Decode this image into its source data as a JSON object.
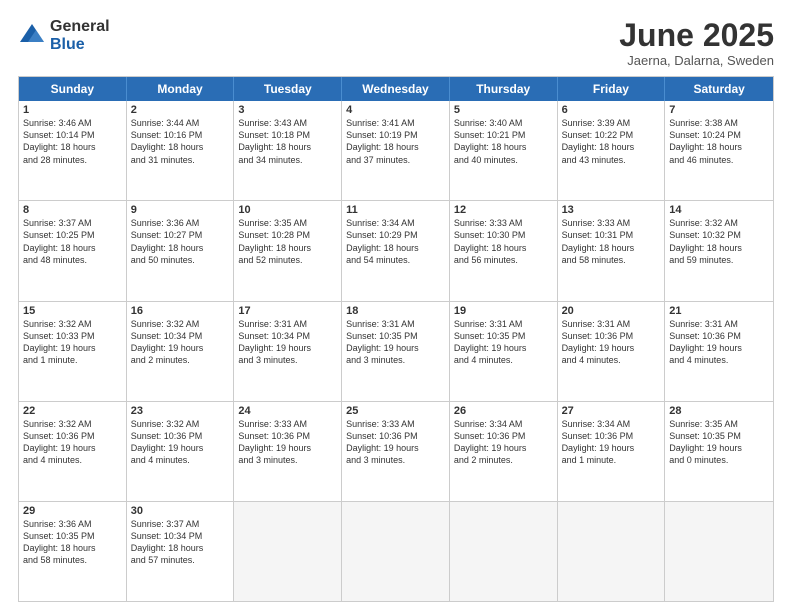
{
  "logo": {
    "general": "General",
    "blue": "Blue"
  },
  "title": "June 2025",
  "subtitle": "Jaerna, Dalarna, Sweden",
  "header_days": [
    "Sunday",
    "Monday",
    "Tuesday",
    "Wednesday",
    "Thursday",
    "Friday",
    "Saturday"
  ],
  "weeks": [
    [
      {
        "day": "1",
        "lines": [
          "Sunrise: 3:46 AM",
          "Sunset: 10:14 PM",
          "Daylight: 18 hours",
          "and 28 minutes."
        ]
      },
      {
        "day": "2",
        "lines": [
          "Sunrise: 3:44 AM",
          "Sunset: 10:16 PM",
          "Daylight: 18 hours",
          "and 31 minutes."
        ]
      },
      {
        "day": "3",
        "lines": [
          "Sunrise: 3:43 AM",
          "Sunset: 10:18 PM",
          "Daylight: 18 hours",
          "and 34 minutes."
        ]
      },
      {
        "day": "4",
        "lines": [
          "Sunrise: 3:41 AM",
          "Sunset: 10:19 PM",
          "Daylight: 18 hours",
          "and 37 minutes."
        ]
      },
      {
        "day": "5",
        "lines": [
          "Sunrise: 3:40 AM",
          "Sunset: 10:21 PM",
          "Daylight: 18 hours",
          "and 40 minutes."
        ]
      },
      {
        "day": "6",
        "lines": [
          "Sunrise: 3:39 AM",
          "Sunset: 10:22 PM",
          "Daylight: 18 hours",
          "and 43 minutes."
        ]
      },
      {
        "day": "7",
        "lines": [
          "Sunrise: 3:38 AM",
          "Sunset: 10:24 PM",
          "Daylight: 18 hours",
          "and 46 minutes."
        ]
      }
    ],
    [
      {
        "day": "8",
        "lines": [
          "Sunrise: 3:37 AM",
          "Sunset: 10:25 PM",
          "Daylight: 18 hours",
          "and 48 minutes."
        ]
      },
      {
        "day": "9",
        "lines": [
          "Sunrise: 3:36 AM",
          "Sunset: 10:27 PM",
          "Daylight: 18 hours",
          "and 50 minutes."
        ]
      },
      {
        "day": "10",
        "lines": [
          "Sunrise: 3:35 AM",
          "Sunset: 10:28 PM",
          "Daylight: 18 hours",
          "and 52 minutes."
        ]
      },
      {
        "day": "11",
        "lines": [
          "Sunrise: 3:34 AM",
          "Sunset: 10:29 PM",
          "Daylight: 18 hours",
          "and 54 minutes."
        ]
      },
      {
        "day": "12",
        "lines": [
          "Sunrise: 3:33 AM",
          "Sunset: 10:30 PM",
          "Daylight: 18 hours",
          "and 56 minutes."
        ]
      },
      {
        "day": "13",
        "lines": [
          "Sunrise: 3:33 AM",
          "Sunset: 10:31 PM",
          "Daylight: 18 hours",
          "and 58 minutes."
        ]
      },
      {
        "day": "14",
        "lines": [
          "Sunrise: 3:32 AM",
          "Sunset: 10:32 PM",
          "Daylight: 18 hours",
          "and 59 minutes."
        ]
      }
    ],
    [
      {
        "day": "15",
        "lines": [
          "Sunrise: 3:32 AM",
          "Sunset: 10:33 PM",
          "Daylight: 19 hours",
          "and 1 minute."
        ]
      },
      {
        "day": "16",
        "lines": [
          "Sunrise: 3:32 AM",
          "Sunset: 10:34 PM",
          "Daylight: 19 hours",
          "and 2 minutes."
        ]
      },
      {
        "day": "17",
        "lines": [
          "Sunrise: 3:31 AM",
          "Sunset: 10:34 PM",
          "Daylight: 19 hours",
          "and 3 minutes."
        ]
      },
      {
        "day": "18",
        "lines": [
          "Sunrise: 3:31 AM",
          "Sunset: 10:35 PM",
          "Daylight: 19 hours",
          "and 3 minutes."
        ]
      },
      {
        "day": "19",
        "lines": [
          "Sunrise: 3:31 AM",
          "Sunset: 10:35 PM",
          "Daylight: 19 hours",
          "and 4 minutes."
        ]
      },
      {
        "day": "20",
        "lines": [
          "Sunrise: 3:31 AM",
          "Sunset: 10:36 PM",
          "Daylight: 19 hours",
          "and 4 minutes."
        ]
      },
      {
        "day": "21",
        "lines": [
          "Sunrise: 3:31 AM",
          "Sunset: 10:36 PM",
          "Daylight: 19 hours",
          "and 4 minutes."
        ]
      }
    ],
    [
      {
        "day": "22",
        "lines": [
          "Sunrise: 3:32 AM",
          "Sunset: 10:36 PM",
          "Daylight: 19 hours",
          "and 4 minutes."
        ]
      },
      {
        "day": "23",
        "lines": [
          "Sunrise: 3:32 AM",
          "Sunset: 10:36 PM",
          "Daylight: 19 hours",
          "and 4 minutes."
        ]
      },
      {
        "day": "24",
        "lines": [
          "Sunrise: 3:33 AM",
          "Sunset: 10:36 PM",
          "Daylight: 19 hours",
          "and 3 minutes."
        ]
      },
      {
        "day": "25",
        "lines": [
          "Sunrise: 3:33 AM",
          "Sunset: 10:36 PM",
          "Daylight: 19 hours",
          "and 3 minutes."
        ]
      },
      {
        "day": "26",
        "lines": [
          "Sunrise: 3:34 AM",
          "Sunset: 10:36 PM",
          "Daylight: 19 hours",
          "and 2 minutes."
        ]
      },
      {
        "day": "27",
        "lines": [
          "Sunrise: 3:34 AM",
          "Sunset: 10:36 PM",
          "Daylight: 19 hours",
          "and 1 minute."
        ]
      },
      {
        "day": "28",
        "lines": [
          "Sunrise: 3:35 AM",
          "Sunset: 10:35 PM",
          "Daylight: 19 hours",
          "and 0 minutes."
        ]
      }
    ],
    [
      {
        "day": "29",
        "lines": [
          "Sunrise: 3:36 AM",
          "Sunset: 10:35 PM",
          "Daylight: 18 hours",
          "and 58 minutes."
        ]
      },
      {
        "day": "30",
        "lines": [
          "Sunrise: 3:37 AM",
          "Sunset: 10:34 PM",
          "Daylight: 18 hours",
          "and 57 minutes."
        ]
      },
      {
        "day": "",
        "lines": []
      },
      {
        "day": "",
        "lines": []
      },
      {
        "day": "",
        "lines": []
      },
      {
        "day": "",
        "lines": []
      },
      {
        "day": "",
        "lines": []
      }
    ]
  ]
}
